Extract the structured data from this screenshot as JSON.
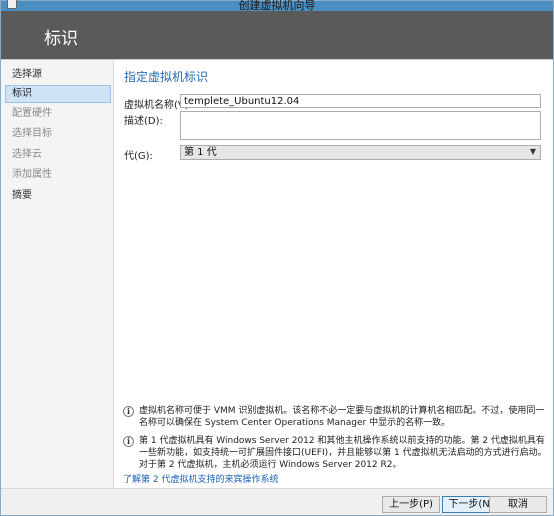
{
  "window": {
    "title": "创建虚拟机向导"
  },
  "banner": {
    "title": "标识"
  },
  "sidebar": {
    "items": [
      {
        "label": "选择源",
        "state": "normal"
      },
      {
        "label": "标识",
        "state": "active"
      },
      {
        "label": "配置硬件",
        "state": "disabled"
      },
      {
        "label": "选择目标",
        "state": "disabled"
      },
      {
        "label": "选择云",
        "state": "disabled"
      },
      {
        "label": "添加属性",
        "state": "disabled"
      },
      {
        "label": "摘要",
        "state": "normal"
      }
    ]
  },
  "form": {
    "heading": "指定虚拟机标识",
    "name_label": "虚拟机名称(V):",
    "name_value": "templete_Ubuntu12.04",
    "desc_label": "描述(D):",
    "desc_value": "",
    "gen_label": "代(G):",
    "gen_value": "第 1 代"
  },
  "info": {
    "note1": "虚拟机名称可便于 VMM 识别虚拟机。该名称不必一定要与虚拟机的计算机名相匹配。不过，使用同一名称可以确保在 System Center Operations Manager 中显示的名称一致。",
    "note2": "第 1 代虚拟机具有 Windows Server 2012 和其他主机操作系统以前支持的功能。第 2 代虚拟机具有一些新功能，如支持统一可扩展固件接口(UEFI)，并且能够以第 1 代虚拟机无法启动的方式进行启动。对于第 2 代虚拟机，主机必须运行 Windows Server 2012 R2。",
    "link": "了解第 2 代虚拟机支持的来宾操作系统"
  },
  "footer": {
    "prev": "上一步(P)",
    "next": "下一步(N)",
    "cancel": "取消"
  },
  "colors": {
    "banner": "#5a5a5a",
    "accent": "#2a6bb0",
    "active_nav": "#cfe3f7"
  }
}
